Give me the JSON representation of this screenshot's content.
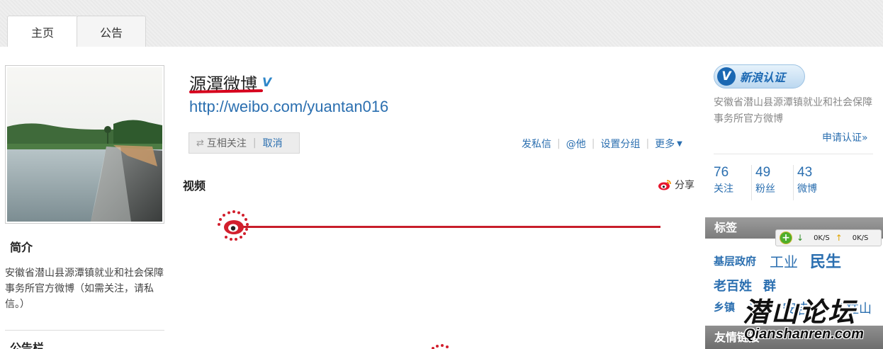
{
  "tabs": [
    {
      "label": "主页",
      "active": true
    },
    {
      "label": "公告",
      "active": false
    }
  ],
  "profile": {
    "name": "源潭微博",
    "verified_mark": "V",
    "url": "http://weibo.com/yuantan016",
    "intro_title": "简介",
    "intro_text": "安徽省潜山县源潭镇就业和社会保障事务所官方微博（如需关注，请私信。）",
    "board_title": "公告栏"
  },
  "follow": {
    "arrows_icon": "⇄",
    "mutual_label": "互相关注",
    "separator": "|",
    "cancel_label": "取消"
  },
  "actions": {
    "message": "发私信",
    "mention": "@他",
    "group": "设置分组",
    "more": "更多",
    "caret": "▼"
  },
  "video": {
    "label": "视频",
    "share_label": "分享"
  },
  "auth": {
    "badge_v": "V",
    "badge_label": "新浪认证",
    "description": "安徽省潜山县源潭镇就业和社会保障事务所官方微博",
    "apply_link": "申请认证»"
  },
  "stats": [
    {
      "num": "76",
      "label": "关注"
    },
    {
      "num": "49",
      "label": "粉丝"
    },
    {
      "num": "43",
      "label": "微博"
    }
  ],
  "tags_header": "标签",
  "tags": [
    "基层政府",
    "工业",
    "民生",
    "老百姓",
    "群",
    "乡镇",
    "当",
    "安吉",
    "天柱山"
  ],
  "friends_header": "友情链接",
  "speed_widget": {
    "plus": "+",
    "down_arrow": "↓",
    "down_speed": "0K/S",
    "up_arrow": "↑",
    "up_speed": "0K/S"
  },
  "watermark": {
    "big": "潜山论坛",
    "small": "Qianshanren.com"
  },
  "colors": {
    "link": "#2b6fb0",
    "accent_red": "#c81d2a",
    "header_gray": "#8a8a8a"
  }
}
